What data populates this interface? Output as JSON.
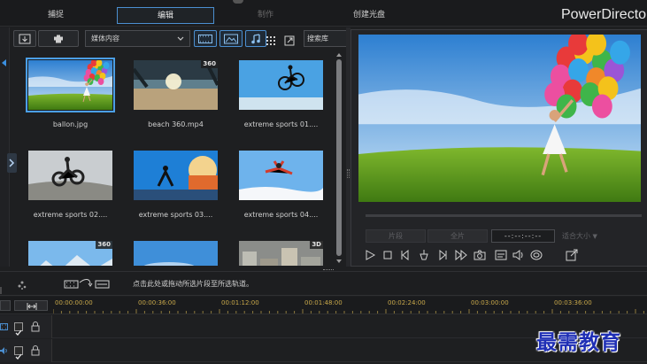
{
  "app": {
    "brand": "PowerDirecto",
    "tabs": [
      {
        "label": "捕捉",
        "state": "normal"
      },
      {
        "label": "编辑",
        "state": "active"
      },
      {
        "label": "制作",
        "state": "disabled"
      },
      {
        "label": "创建光盘",
        "state": "normal"
      }
    ]
  },
  "library": {
    "dropdown_value": "媒体内容",
    "search_placeholder": "搜索库",
    "toolbar_icons": [
      "import-icon",
      "plugin-icon",
      "video-filter-icon",
      "image-filter-icon",
      "audio-filter-icon",
      "grid-view-icon",
      "detach-icon"
    ],
    "items": [
      {
        "name": "ballon.jpg",
        "badge": "",
        "selected": true,
        "scene": "balloon"
      },
      {
        "name": "beach 360.mp4",
        "badge": "360",
        "selected": false,
        "scene": "beach"
      },
      {
        "name": "extreme sports 01....",
        "badge": "",
        "selected": false,
        "scene": "bmx"
      },
      {
        "name": "extreme sports 02....",
        "badge": "",
        "selected": false,
        "scene": "moto"
      },
      {
        "name": "extreme sports 03....",
        "badge": "",
        "selected": false,
        "scene": "skate"
      },
      {
        "name": "extreme sports 04....",
        "badge": "",
        "selected": false,
        "scene": "skydive"
      },
      {
        "name": "",
        "badge": "360",
        "selected": false,
        "scene": "mountain"
      },
      {
        "name": "",
        "badge": "",
        "selected": false,
        "scene": "sky"
      },
      {
        "name": "",
        "badge": "3D",
        "selected": false,
        "scene": "city"
      }
    ]
  },
  "preview": {
    "scene": "balloon",
    "progress": 0,
    "play_button_label": "片段",
    "movie_button_label": "全片",
    "timecode": "--:--:--:--",
    "fit_label": "适合大小",
    "controls": [
      "play-icon",
      "stop-icon",
      "previous-frame-icon",
      "split-icon",
      "next-frame-icon",
      "fast-forward-icon",
      "snapshot-icon",
      "subtitle-icon",
      "volume-icon",
      "3d-icon",
      "undock-icon"
    ]
  },
  "timeline": {
    "hint": "点击此处或拖动所选片段至所选轨道。",
    "ruler": [
      "00:00:00:00",
      "00:00:36:00",
      "00:01:12:00",
      "00:01:48:00",
      "00:02:24:00",
      "00:03:00:00",
      "00:03:36:00"
    ],
    "tracks": [
      {
        "type": "video",
        "enabled": true
      },
      {
        "type": "audio",
        "enabled": true
      }
    ]
  },
  "watermark": "最需教育"
}
